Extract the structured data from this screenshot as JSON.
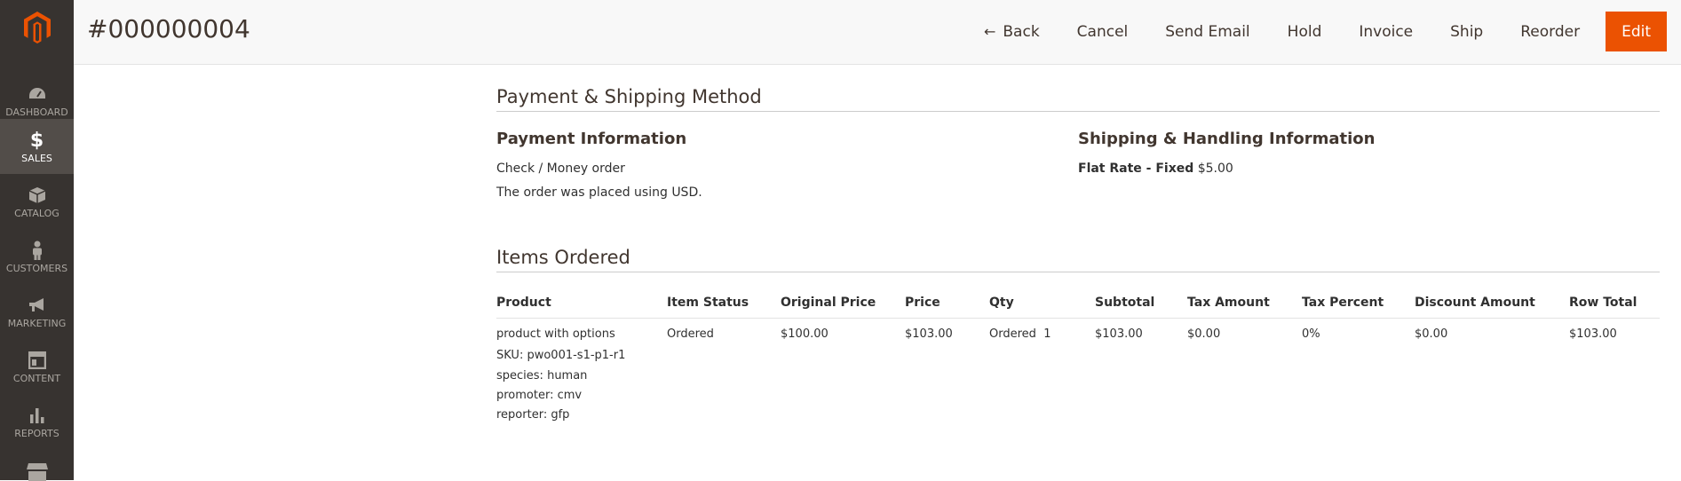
{
  "sidebar": {
    "items": [
      {
        "label": "DASHBOARD",
        "icon": "dashboard-icon"
      },
      {
        "label": "SALES",
        "icon": "dollar-icon"
      },
      {
        "label": "CATALOG",
        "icon": "box-icon"
      },
      {
        "label": "CUSTOMERS",
        "icon": "person-icon"
      },
      {
        "label": "MARKETING",
        "icon": "megaphone-icon"
      },
      {
        "label": "CONTENT",
        "icon": "layout-icon"
      },
      {
        "label": "REPORTS",
        "icon": "bar-chart-icon"
      },
      {
        "label": "",
        "icon": "store-icon"
      }
    ]
  },
  "header": {
    "title": "#000000004",
    "actions": {
      "back": "Back",
      "cancel": "Cancel",
      "send_email": "Send Email",
      "hold": "Hold",
      "invoice": "Invoice",
      "ship": "Ship",
      "reorder": "Reorder",
      "edit": "Edit"
    }
  },
  "payment_shipping": {
    "title": "Payment & Shipping Method",
    "payment": {
      "title": "Payment Information",
      "method": "Check / Money order",
      "currency_note": "The order was placed using USD."
    },
    "shipping": {
      "title": "Shipping & Handling Information",
      "method": "Flat Rate - Fixed",
      "price": "$5.00"
    }
  },
  "items_ordered": {
    "title": "Items Ordered",
    "columns": [
      "Product",
      "Item Status",
      "Original Price",
      "Price",
      "Qty",
      "Subtotal",
      "Tax Amount",
      "Tax Percent",
      "Discount Amount",
      "Row Total"
    ],
    "rows": [
      {
        "product": "product with options",
        "sku": "SKU: pwo001-s1-p1-r1",
        "options": [
          {
            "label": "species:",
            "value": "human"
          },
          {
            "label": "promoter:",
            "value": "cmv"
          },
          {
            "label": "reporter:",
            "value": "gfp"
          }
        ],
        "item_status": "Ordered",
        "original_price": "$100.00",
        "price": "$103.00",
        "qty_label": "Ordered",
        "qty_value": "1",
        "subtotal": "$103.00",
        "tax_amount": "$0.00",
        "tax_percent": "0%",
        "discount_amount": "$0.00",
        "row_total": "$103.00"
      }
    ]
  },
  "colors": {
    "sidebar_bg": "#373330",
    "sidebar_active": "#524d49",
    "accent": "#eb5202"
  }
}
